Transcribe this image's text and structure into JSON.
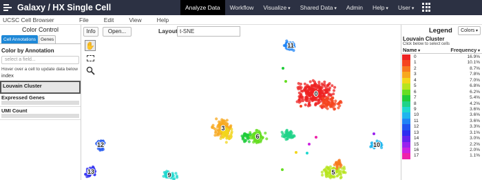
{
  "topbar": {
    "brand": "Galaxy / HX Single Cell",
    "nav": [
      {
        "label": "Analyze Data",
        "active": true,
        "caret": false
      },
      {
        "label": "Workflow",
        "active": false,
        "caret": false
      },
      {
        "label": "Visualize",
        "active": false,
        "caret": true
      },
      {
        "label": "Shared Data",
        "active": false,
        "caret": true
      },
      {
        "label": "Admin",
        "active": false,
        "caret": false
      },
      {
        "label": "Help",
        "active": false,
        "caret": true
      },
      {
        "label": "User",
        "active": false,
        "caret": true
      }
    ]
  },
  "menubar": {
    "app_title": "UCSC Cell Browser",
    "menus": [
      "File",
      "Edit",
      "View",
      "Help"
    ]
  },
  "left_panel": {
    "title": "Color Control",
    "tabs": [
      "Cell Annotations",
      "Genes"
    ],
    "color_by_label": "Color by Annotation",
    "select_placeholder": "select a field...",
    "hover_hint": "Hover over a cell to update data below",
    "index_label": "index",
    "annotations": [
      {
        "label": "Louvain Cluster",
        "selected": true
      },
      {
        "label": "Expressed Genes",
        "selected": false
      },
      {
        "label": "UMI Count",
        "selected": false
      }
    ]
  },
  "plot": {
    "info_button": "Info",
    "open_button": "Open...",
    "layout_label": "Layout",
    "layout_value": "t-SNE",
    "cluster_labels": [
      "0",
      "3",
      "6",
      "10",
      "11",
      "12",
      "13",
      "5",
      "9"
    ]
  },
  "legend": {
    "title": "Legend",
    "colors_button": "Colors",
    "subtitle": "Louvain Cluster",
    "hint": "Click below to select cells",
    "col_name": "Name",
    "col_freq": "Frequency",
    "rows": [
      {
        "name": "0",
        "freq": "16.9%",
        "color": "#ee2222"
      },
      {
        "name": "1",
        "freq": "10.1%",
        "color": "#f5461f"
      },
      {
        "name": "2",
        "freq": "8.7%",
        "color": "#f77a1f"
      },
      {
        "name": "3",
        "freq": "7.8%",
        "color": "#f7a81f"
      },
      {
        "name": "4",
        "freq": "7.0%",
        "color": "#f2d61c"
      },
      {
        "name": "5",
        "freq": "6.8%",
        "color": "#b7e41f"
      },
      {
        "name": "6",
        "freq": "6.2%",
        "color": "#66dd22"
      },
      {
        "name": "7",
        "freq": "5.4%",
        "color": "#1fcc3a"
      },
      {
        "name": "8",
        "freq": "4.2%",
        "color": "#1fd388"
      },
      {
        "name": "9",
        "freq": "3.6%",
        "color": "#1fd8cf"
      },
      {
        "name": "10",
        "freq": "3.6%",
        "color": "#1fb5ee"
      },
      {
        "name": "11",
        "freq": "3.6%",
        "color": "#1f84f5"
      },
      {
        "name": "12",
        "freq": "3.3%",
        "color": "#1f55f0"
      },
      {
        "name": "13",
        "freq": "3.1%",
        "color": "#2d2df0"
      },
      {
        "name": "14",
        "freq": "3.0%",
        "color": "#6422ee"
      },
      {
        "name": "15",
        "freq": "2.2%",
        "color": "#9a22ee"
      },
      {
        "name": "16",
        "freq": "2.0%",
        "color": "#cc22e0"
      },
      {
        "name": "17",
        "freq": "1.1%",
        "color": "#ee22aa"
      }
    ]
  }
}
